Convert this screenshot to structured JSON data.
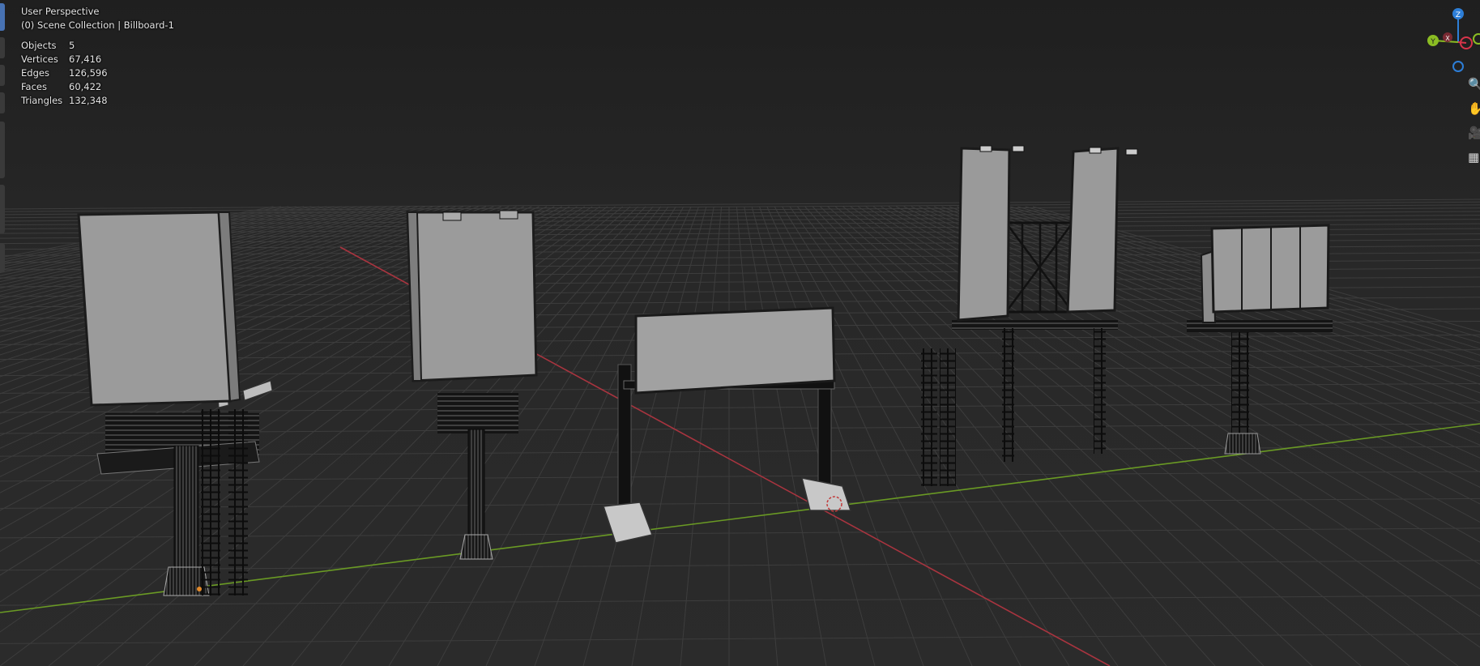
{
  "viewport": {
    "view_name": "User Perspective",
    "collection_info": "(0) Scene Collection | Billboard-1",
    "stats": [
      {
        "label": "Objects",
        "value": "5"
      },
      {
        "label": "Vertices",
        "value": "67,416"
      },
      {
        "label": "Edges",
        "value": "126,596"
      },
      {
        "label": "Faces",
        "value": "60,422"
      },
      {
        "label": "Triangles",
        "value": "132,348"
      }
    ]
  },
  "gizmo": {
    "z_label": "Z",
    "y_label": "Y",
    "x_label": "X",
    "colors": {
      "x": "#d8344a",
      "y": "#8bbd23",
      "z": "#2d7ed7"
    }
  },
  "right_toolbar": {
    "icons": [
      "zoom-icon",
      "pan-hand-icon",
      "camera-icon",
      "grid-view-icon"
    ]
  },
  "colors": {
    "background": "#2a2a2a",
    "grid": "#3a3a3a",
    "x_axis": "#a8343f",
    "y_axis": "#6a9a24",
    "billboard_face": "#9b9b9b",
    "structure": "#0e0e0e",
    "accent": "#4772b3"
  }
}
